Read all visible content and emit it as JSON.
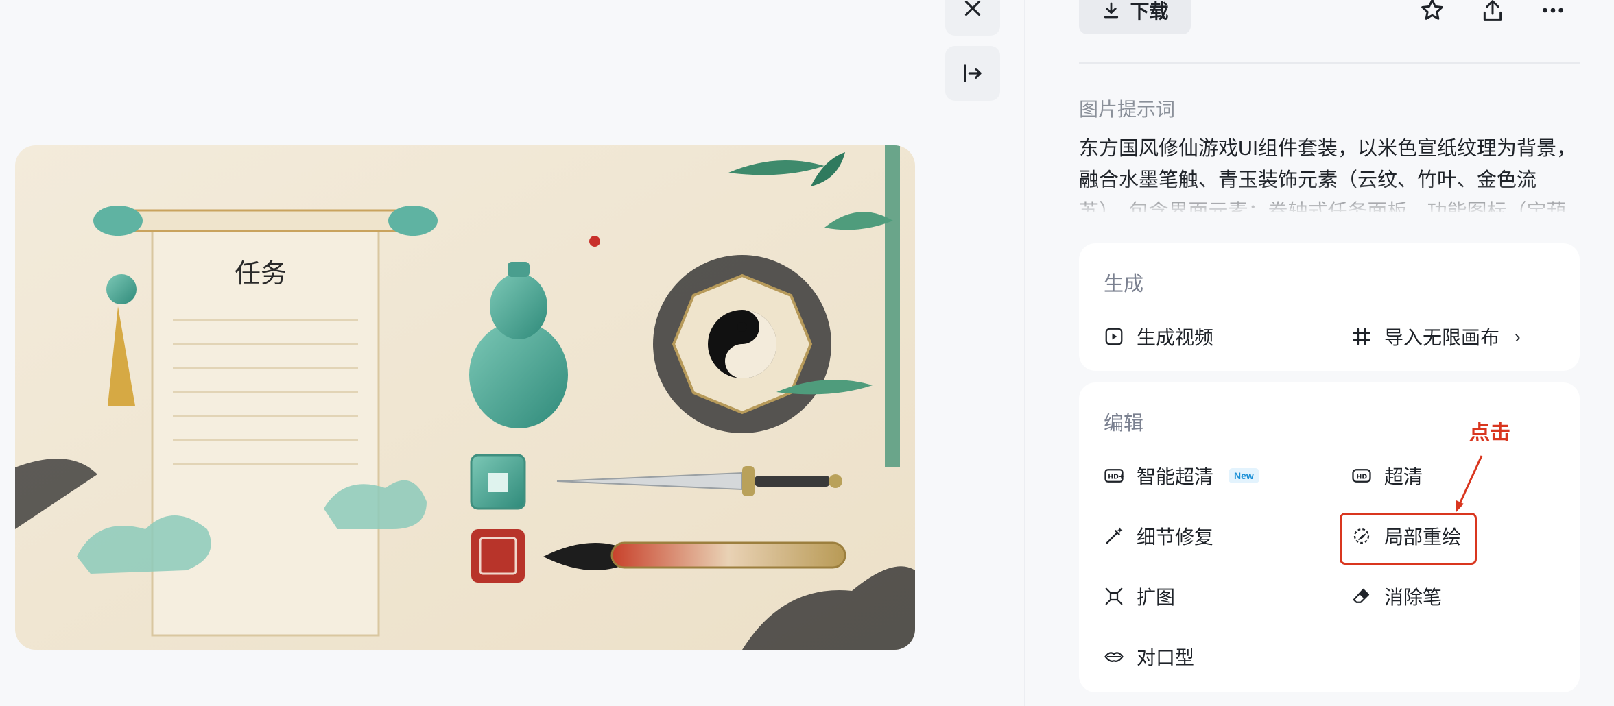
{
  "toolbar": {
    "download_label": "下载",
    "icons": [
      "download-icon",
      "star-icon",
      "share-icon",
      "more-icon"
    ]
  },
  "side_buttons": {
    "icons": [
      "close-icon",
      "collapse-panel-icon"
    ]
  },
  "artwork": {
    "scroll_title": "任务"
  },
  "prompt": {
    "label": "图片提示词",
    "text": "东方国风修仙游戏UI组件套装，以米色宣纸纹理为背景，融合水墨笔触、青玉装饰元素（云纹、竹叶、金色流苏）。包含界面元素：卷轴式任务面板，功能图标（宝葫芦、八卦"
  },
  "generate": {
    "title": "生成",
    "items": [
      {
        "label": "生成视频",
        "icon": "play-video-icon"
      },
      {
        "label": "导入无限画布",
        "icon": "canvas-import-icon"
      }
    ]
  },
  "edit": {
    "title": "编辑",
    "items": [
      {
        "label": "智能超清",
        "icon": "hd-plus-icon",
        "badge": "New"
      },
      {
        "label": "超清",
        "icon": "hd-icon"
      },
      {
        "label": "细节修复",
        "icon": "magic-wand-icon"
      },
      {
        "label": "局部重绘",
        "icon": "repaint-icon"
      },
      {
        "label": "扩图",
        "icon": "expand-icon"
      },
      {
        "label": "消除笔",
        "icon": "eraser-icon"
      },
      {
        "label": "对口型",
        "icon": "lips-icon"
      }
    ]
  },
  "annotation": {
    "label": "点击",
    "color": "#d9361f"
  },
  "colors": {
    "accent_red": "#d9361f",
    "badge_blue": "#1a8fd6",
    "card_bg": "#ffffff",
    "page_bg": "#f7f8fa"
  }
}
